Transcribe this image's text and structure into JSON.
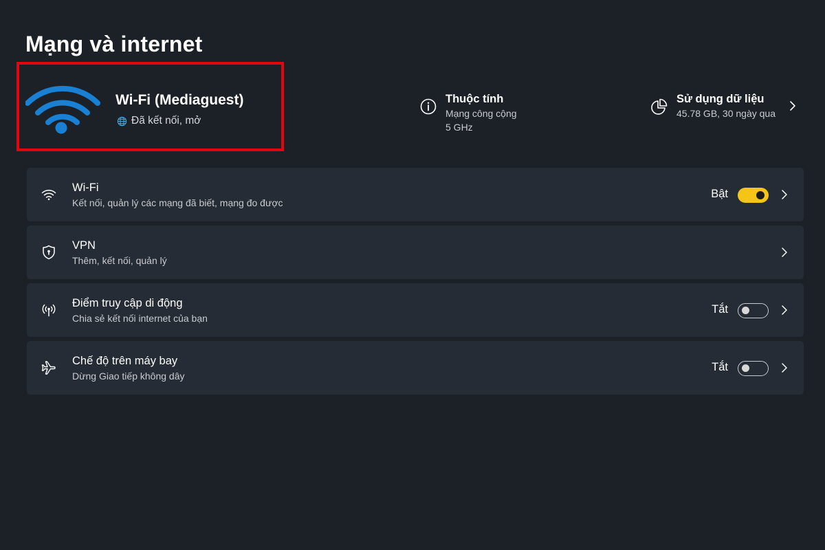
{
  "page": {
    "title": "Mạng và internet"
  },
  "connection": {
    "name": "Wi-Fi (Mediaguest)",
    "status": "Đã kết nối, mở"
  },
  "properties": {
    "title": "Thuộc tính",
    "network_type": "Mạng công cộng",
    "band": "5 GHz"
  },
  "data_usage": {
    "title": "Sử dụng dữ liệu",
    "detail": "45.78 GB, 30 ngày qua"
  },
  "settings": [
    {
      "id": "wifi",
      "title": "Wi-Fi",
      "subtitle": "Kết nối, quản lý các mạng đã biết, mạng đo được",
      "state_label": "Bật",
      "toggle_on": true,
      "icon": "wifi-icon"
    },
    {
      "id": "vpn",
      "title": "VPN",
      "subtitle": "Thêm, kết nối, quản lý",
      "icon": "shield-icon"
    },
    {
      "id": "hotspot",
      "title": "Điểm truy cập di động",
      "subtitle": "Chia sẻ kết nối internet của bạn",
      "state_label": "Tắt",
      "toggle_on": false,
      "icon": "hotspot-icon"
    },
    {
      "id": "airplane",
      "title": "Chế độ trên máy bay",
      "subtitle": "Dừng Giao tiếp không dây",
      "state_label": "Tắt",
      "toggle_on": false,
      "icon": "airplane-icon"
    }
  ],
  "colors": {
    "background": "#1c2128",
    "card": "#262c35",
    "accent_toggle": "#f4c518",
    "wifi_blue": "#1a80d4",
    "highlight_frame": "#e3060f"
  }
}
